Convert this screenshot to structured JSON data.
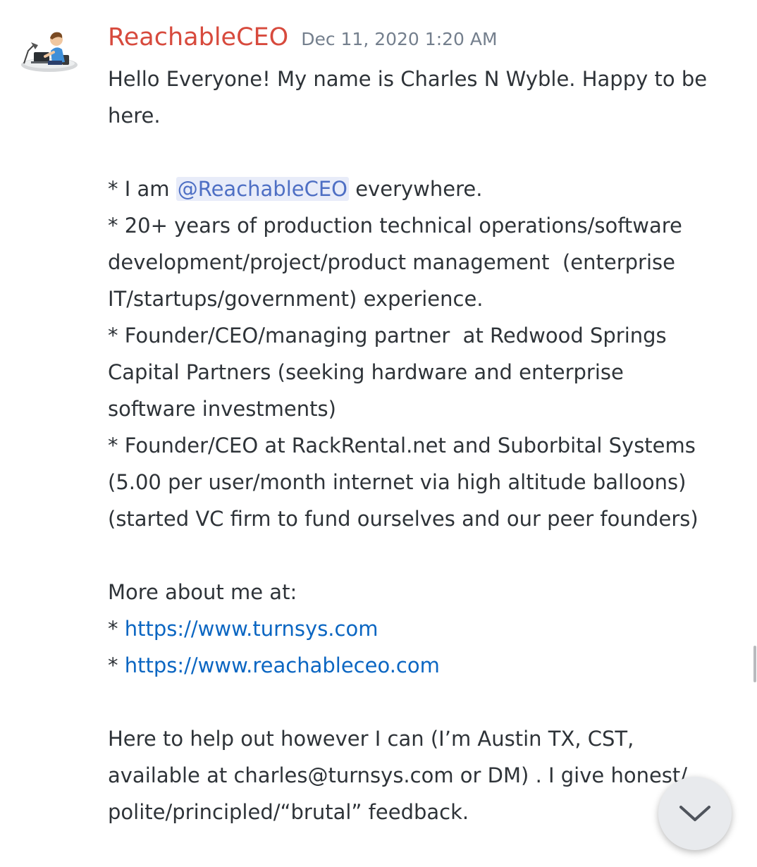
{
  "message": {
    "author": "ReachableCEO",
    "timestamp": "Dec 11, 2020 1:20 AM",
    "avatar_icon": "person-at-laptop-icon",
    "author_color": "#d74a3d",
    "lines": {
      "l1": "Hello Everyone! My name is Charles N Wyble. Happy to be",
      "l2": "here.",
      "l3_prefix": "* I am ",
      "l3_mention": "@ReachableCEO",
      "l3_suffix": " everywhere.",
      "l4": "* 20+ years of production technical operations/software",
      "l5": "development/project/product management  (enterprise",
      "l6": "IT/startups/government) experience.",
      "l7": "* Founder/CEO/managing partner  at Redwood Springs",
      "l8": "Capital Partners (seeking hardware and enterprise",
      "l9": "software investments)",
      "l10": "* Founder/CEO at RackRental.net and Suborbital Systems",
      "l11": "(5.00 per user/month internet via high altitude balloons)",
      "l12": "(started VC firm to fund ourselves and our peer founders)",
      "l13": "More about me at:",
      "l14_prefix": "* ",
      "l14_link": "https://www.turnsys.com",
      "l15_prefix": "* ",
      "l15_link": "https://www.reachableceo.com",
      "l16": "Here to help out however I can (I’m Austin TX, CST,",
      "l17": "available at charles@turnsys.com or DM) . I give honest/",
      "l18": "polite/principled/“brutal” feedback."
    }
  },
  "controls": {
    "jump_icon": "chevron-down-icon"
  }
}
